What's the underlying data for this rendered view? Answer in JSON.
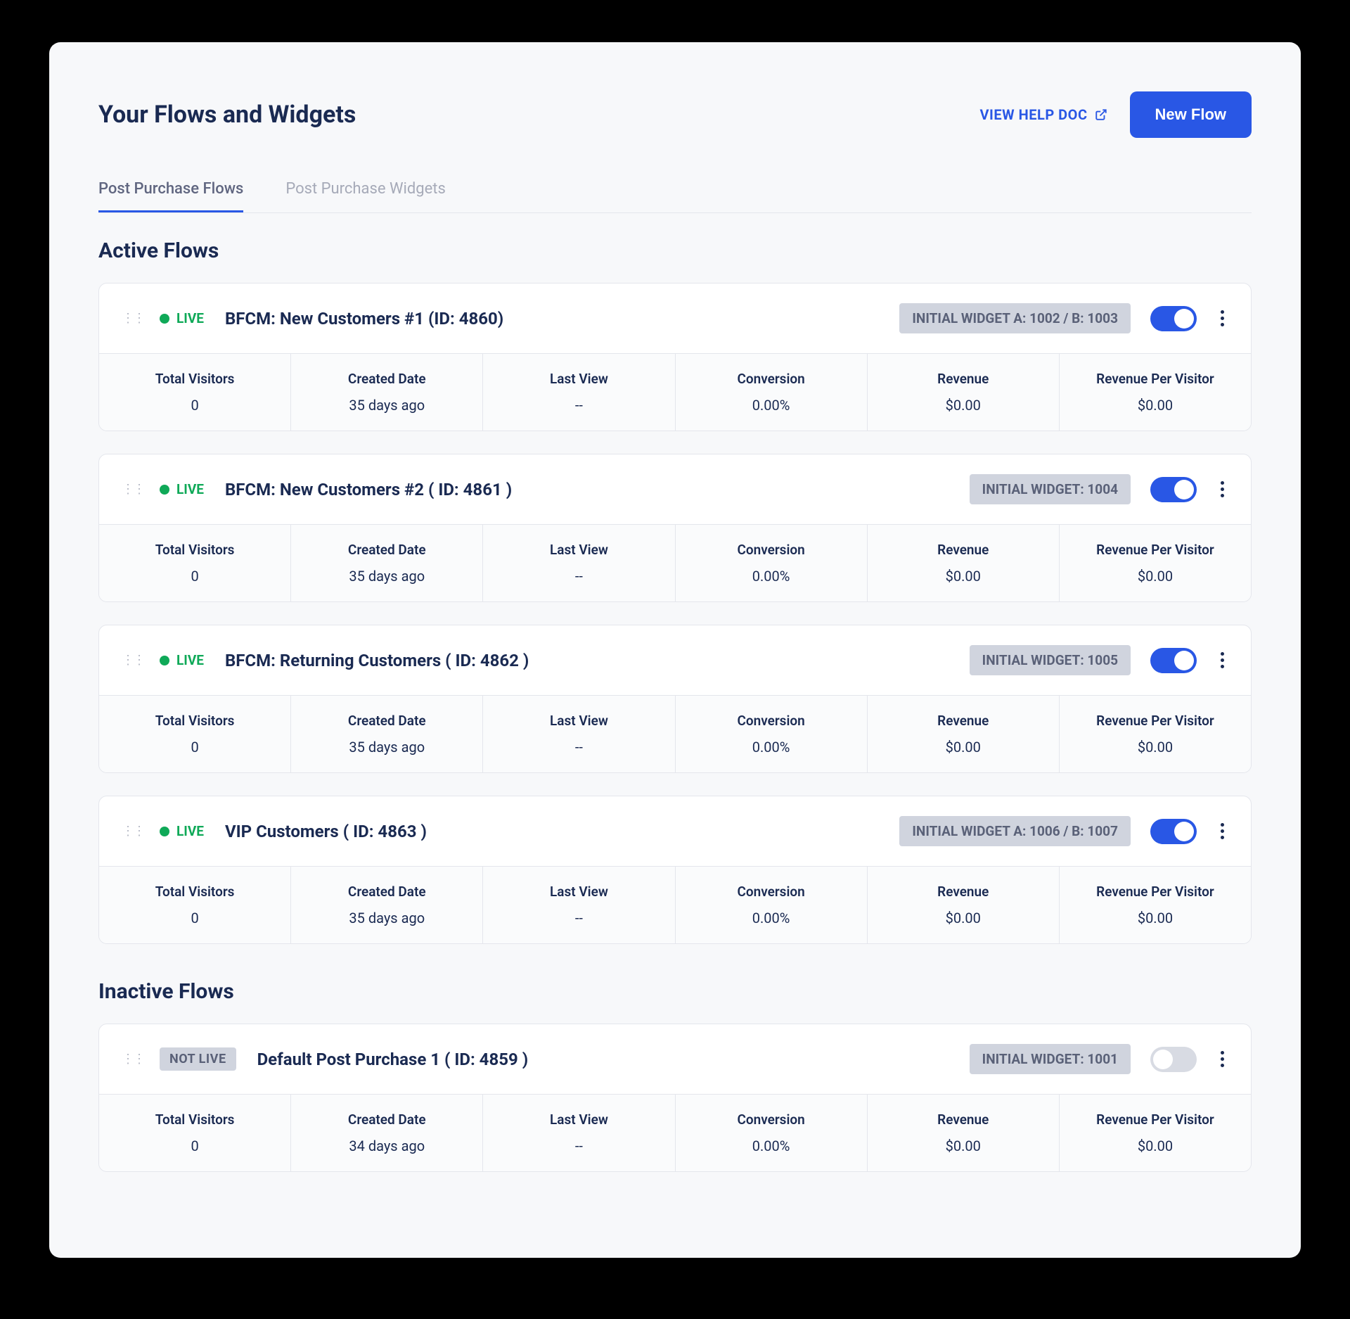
{
  "header": {
    "title": "Your Flows and  Widgets",
    "help_label": "VIEW HELP DOC",
    "new_flow_label": "New Flow"
  },
  "tabs": [
    {
      "label": "Post Purchase Flows",
      "active": true
    },
    {
      "label": "Post Purchase Widgets",
      "active": false
    }
  ],
  "sections": {
    "active_title": "Active Flows",
    "inactive_title": "Inactive Flows"
  },
  "stat_labels": {
    "visitors": "Total Visitors",
    "created": "Created Date",
    "last_view": "Last View",
    "conversion": "Conversion",
    "revenue": "Revenue",
    "rpv": "Revenue Per Visitor"
  },
  "live_label": "LIVE",
  "notlive_label": "NOT LIVE",
  "active_flows": [
    {
      "name": "BFCM: New Customers #1 (ID: 4860)",
      "widget_badge": "INITIAL WIDGET A:  1002  /  B:  1003",
      "toggle_on": true,
      "stats": {
        "visitors": "0",
        "created": "35 days ago",
        "last_view": "--",
        "conversion": "0.00%",
        "revenue": "$0.00",
        "rpv": "$0.00"
      }
    },
    {
      "name": "BFCM: New Customers #2 ( ID: 4861 )",
      "widget_badge": "INITIAL WIDGET:  1004",
      "toggle_on": true,
      "stats": {
        "visitors": "0",
        "created": "35 days ago",
        "last_view": "--",
        "conversion": "0.00%",
        "revenue": "$0.00",
        "rpv": "$0.00"
      }
    },
    {
      "name": "BFCM: Returning Customers ( ID: 4862 )",
      "widget_badge": "INITIAL WIDGET:  1005",
      "toggle_on": true,
      "stats": {
        "visitors": "0",
        "created": "35 days ago",
        "last_view": "--",
        "conversion": "0.00%",
        "revenue": "$0.00",
        "rpv": "$0.00"
      }
    },
    {
      "name": "VIP Customers ( ID: 4863 )",
      "widget_badge": "INITIAL WIDGET A:  1006  /  B:  1007",
      "toggle_on": true,
      "stats": {
        "visitors": "0",
        "created": "35 days ago",
        "last_view": "--",
        "conversion": "0.00%",
        "revenue": "$0.00",
        "rpv": "$0.00"
      }
    }
  ],
  "inactive_flows": [
    {
      "name": "Default Post Purchase 1 ( ID: 4859 )",
      "widget_badge": "INITIAL WIDGET:  1001",
      "toggle_on": false,
      "stats": {
        "visitors": "0",
        "created": "34 days ago",
        "last_view": "--",
        "conversion": "0.00%",
        "revenue": "$0.00",
        "rpv": "$0.00"
      }
    }
  ]
}
